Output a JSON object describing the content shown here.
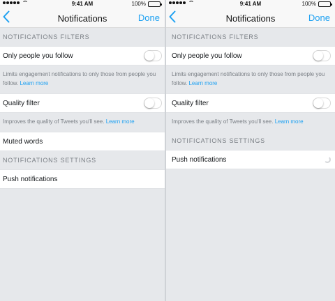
{
  "status": {
    "time": "9:41 AM",
    "battery": "100%",
    "battery_level": 1.0
  },
  "left": {
    "nav": {
      "back_icon": "chevron-left-icon",
      "title": "Notifications",
      "done": "Done"
    },
    "filters_header": "NOTIFICATIONS FILTERS",
    "only_people_label": "Only people you follow",
    "only_people_enabled": false,
    "only_people_desc": "Limits engagement notifications to only those from people you follow.",
    "only_people_link": "Learn more",
    "quality_label": "Quality filter",
    "quality_enabled": false,
    "quality_desc": "Improves the quality of Tweets you'll see.",
    "quality_link": "Learn more",
    "muted_words_label": "Muted words",
    "settings_header": "NOTIFICATIONS SETTINGS",
    "push_label": "Push notifications"
  },
  "right": {
    "nav": {
      "back_icon": "chevron-left-icon",
      "title": "Notifications",
      "done": "Done"
    },
    "filters_header": "NOTIFICATIONS FILTERS",
    "only_people_label": "Only people you follow",
    "only_people_enabled": false,
    "only_people_desc": "Limits engagement notifications to only those from people you follow.",
    "only_people_link": "Learn more",
    "quality_label": "Quality filter",
    "quality_enabled": false,
    "quality_desc": "Improves the quality of Tweets you'll see.",
    "quality_link": "Learn more",
    "settings_header": "NOTIFICATIONS SETTINGS",
    "push_label": "Push notifications",
    "push_loading_icon": "spinner-icon"
  },
  "colors": {
    "accent": "#1da1f2",
    "background": "#e6e8eb",
    "secondary_text": "#7a7f85"
  }
}
